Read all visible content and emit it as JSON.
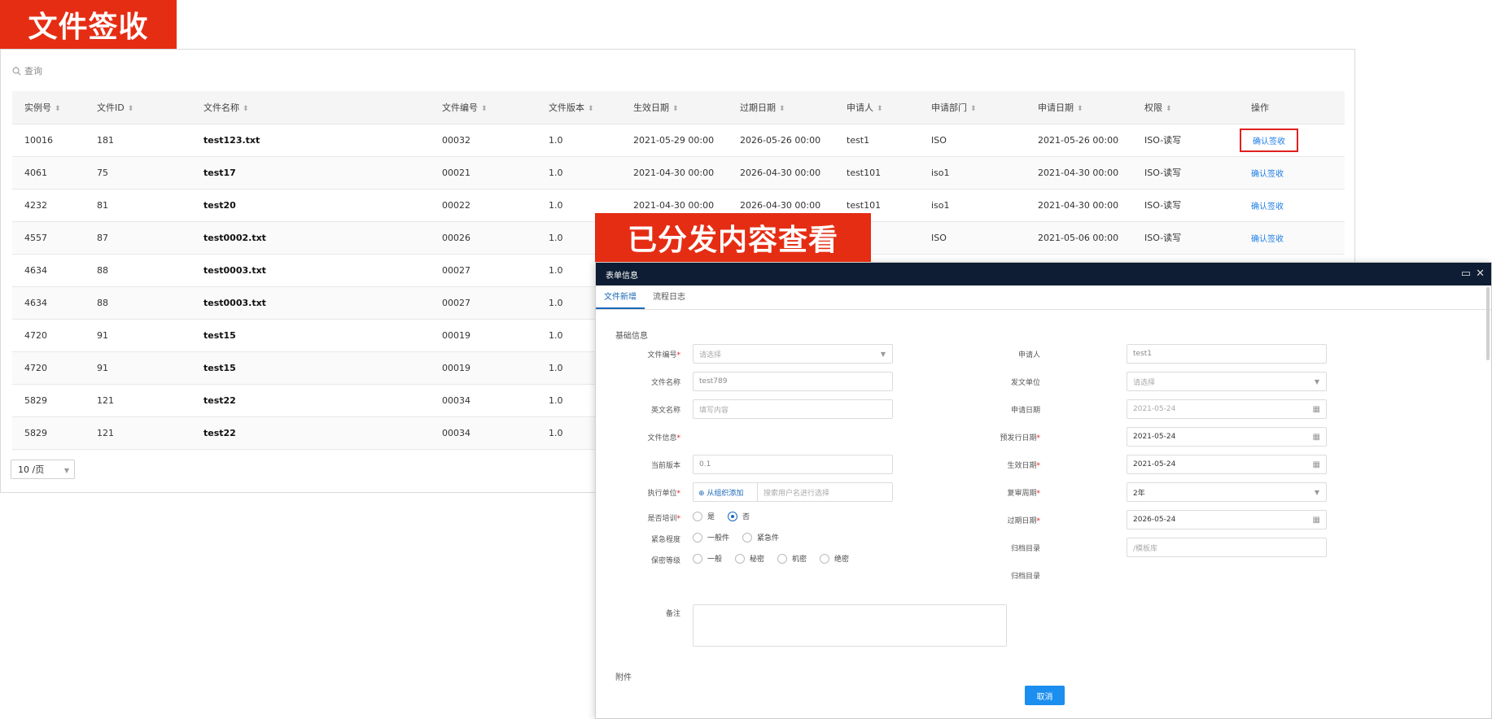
{
  "banners": {
    "top": "文件签收",
    "dialog": "已分发内容查看"
  },
  "list": {
    "search_label": "查询",
    "columns": [
      "实例号",
      "文件ID",
      "文件名称",
      "文件编号",
      "文件版本",
      "生效日期",
      "过期日期",
      "申请人",
      "申请部门",
      "申请日期",
      "权限",
      "操作"
    ],
    "rows": [
      [
        "10016",
        "181",
        "test123.txt",
        "00032",
        "1.0",
        "2021-05-29 00:00",
        "2026-05-26 00:00",
        "test1",
        "ISO",
        "2021-05-26 00:00",
        "ISO-读写",
        "确认签收"
      ],
      [
        "4061",
        "75",
        "test17",
        "00021",
        "1.0",
        "2021-04-30 00:00",
        "2026-04-30 00:00",
        "test101",
        "iso1",
        "2021-04-30 00:00",
        "ISO-读写",
        "确认签收"
      ],
      [
        "4232",
        "81",
        "test20",
        "00022",
        "1.0",
        "2021-04-30 00:00",
        "2026-04-30 00:00",
        "test101",
        "iso1",
        "2021-04-30 00:00",
        "ISO-读写",
        "确认签收"
      ],
      [
        "4557",
        "87",
        "test0002.txt",
        "00026",
        "1.0",
        "",
        "",
        "",
        "ISO",
        "2021-05-06 00:00",
        "ISO-读写",
        "确认签收"
      ],
      [
        "4634",
        "88",
        "test0003.txt",
        "00027",
        "1.0",
        "",
        "",
        "",
        "",
        "",
        "",
        ""
      ],
      [
        "4634",
        "88",
        "test0003.txt",
        "00027",
        "1.0",
        "",
        "",
        "",
        "",
        "",
        "",
        ""
      ],
      [
        "4720",
        "91",
        "test15",
        "00019",
        "1.0",
        "",
        "",
        "",
        "",
        "",
        "",
        ""
      ],
      [
        "4720",
        "91",
        "test15",
        "00019",
        "1.0",
        "",
        "",
        "",
        "",
        "",
        "",
        ""
      ],
      [
        "5829",
        "121",
        "test22",
        "00034",
        "1.0",
        "",
        "",
        "",
        "",
        "",
        "",
        ""
      ],
      [
        "5829",
        "121",
        "test22",
        "00034",
        "1.0",
        "",
        "",
        "",
        "",
        "",
        "",
        ""
      ]
    ],
    "page_size": "10 /页"
  },
  "dialog": {
    "title": "表单信息",
    "tabs": [
      "文件新增",
      "流程日志"
    ],
    "section": "基础信息",
    "left": {
      "file_no_label": "文件编号",
      "file_no_ph": "请选择",
      "file_name_label": "文件名称",
      "file_name_val": "test789",
      "en_name_label": "英文名称",
      "en_name_ph": "填写内容",
      "file_info_label": "文件信息",
      "version_label": "当前版本",
      "version_val": "0.1",
      "exec_unit_label": "执行单位",
      "exec_unit_add": "从组织添加",
      "exec_unit_ph": "搜索用户名进行选择",
      "training_label": "是否培训",
      "training_opts": [
        "是",
        "否"
      ],
      "urgency_label": "紧急程度",
      "urgency_opts": [
        "一般件",
        "紧急件"
      ],
      "secret_label": "保密等级",
      "secret_opts": [
        "一般",
        "秘密",
        "机密",
        "绝密"
      ],
      "remark_label": "备注"
    },
    "right": {
      "applicant_label": "申请人",
      "applicant_val": "test1",
      "issuer_label": "发文单位",
      "issuer_ph": "请选择",
      "apply_date_label": "申请日期",
      "apply_date_val": "2021-05-24",
      "plan_date_label": "预发行日期",
      "plan_date_val": "2021-05-24",
      "effective_label": "生效日期",
      "effective_val": "2021-05-24",
      "review_label": "复审周期",
      "review_val": "2年",
      "expire_label": "过期日期",
      "expire_val": "2026-05-24",
      "archive_label": "归档目录",
      "archive_ph": "/模板库",
      "archive2_label": "归档目录"
    },
    "attachment_label": "附件",
    "cancel": "取消"
  },
  "colors": {
    "banner": "#e52d14",
    "dialog_header": "#0e1d33",
    "link": "#1e7ee6",
    "primary": "#1b8ef0"
  }
}
